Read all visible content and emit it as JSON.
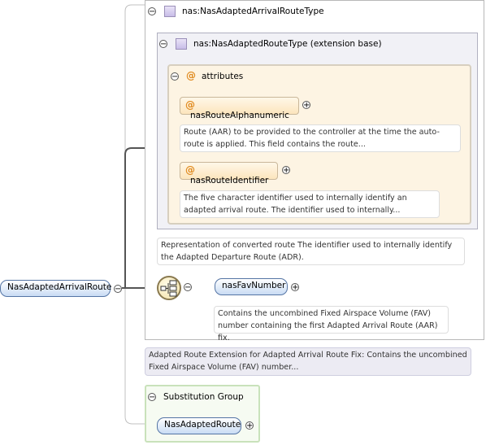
{
  "root": {
    "name": "NasAdaptedArrivalRoute"
  },
  "complex_type": {
    "name": "nas:NasAdaptedArrivalRouteType",
    "extension": {
      "name": "nas:NasAdaptedRouteType (extension base)",
      "attributes_label": "attributes",
      "attributes": [
        {
          "name": "nasRouteAlphanumeric",
          "doc": "Route (AAR) to be provided to the controller at the time the auto-route is applied. This field contains the route..."
        },
        {
          "name": "nasRouteIdentifier",
          "doc": "The five character identifier used to internally identify an adapted arrival route. The identifier used to internally..."
        }
      ],
      "doc": "Representation of converted route The identifier used to internally identify the Adapted Departure Route (ADR)."
    },
    "sequence_child": {
      "name": "nasFavNumber",
      "doc": "Contains the uncombined Fixed Airspace Volume (FAV) number containing the first Adapted Arrival Route (AAR) fix."
    },
    "doc": "Adapted Route Extension for Adapted Arrival Route Fix: Contains the uncombined Fixed Airspace Volume (FAV) number..."
  },
  "substitution_group": {
    "label": "Substitution Group",
    "member": "NasAdaptedRoute"
  },
  "symbols": {
    "collapse": "−",
    "expand": "+",
    "attribute": "@"
  },
  "colors": {
    "element_fill": "#c9dcf4",
    "element_border": "#5575a5",
    "attr_fill": "#fdf4e3",
    "type_fill": "#f1f1f6",
    "subst_border": "#b9d7a9"
  }
}
